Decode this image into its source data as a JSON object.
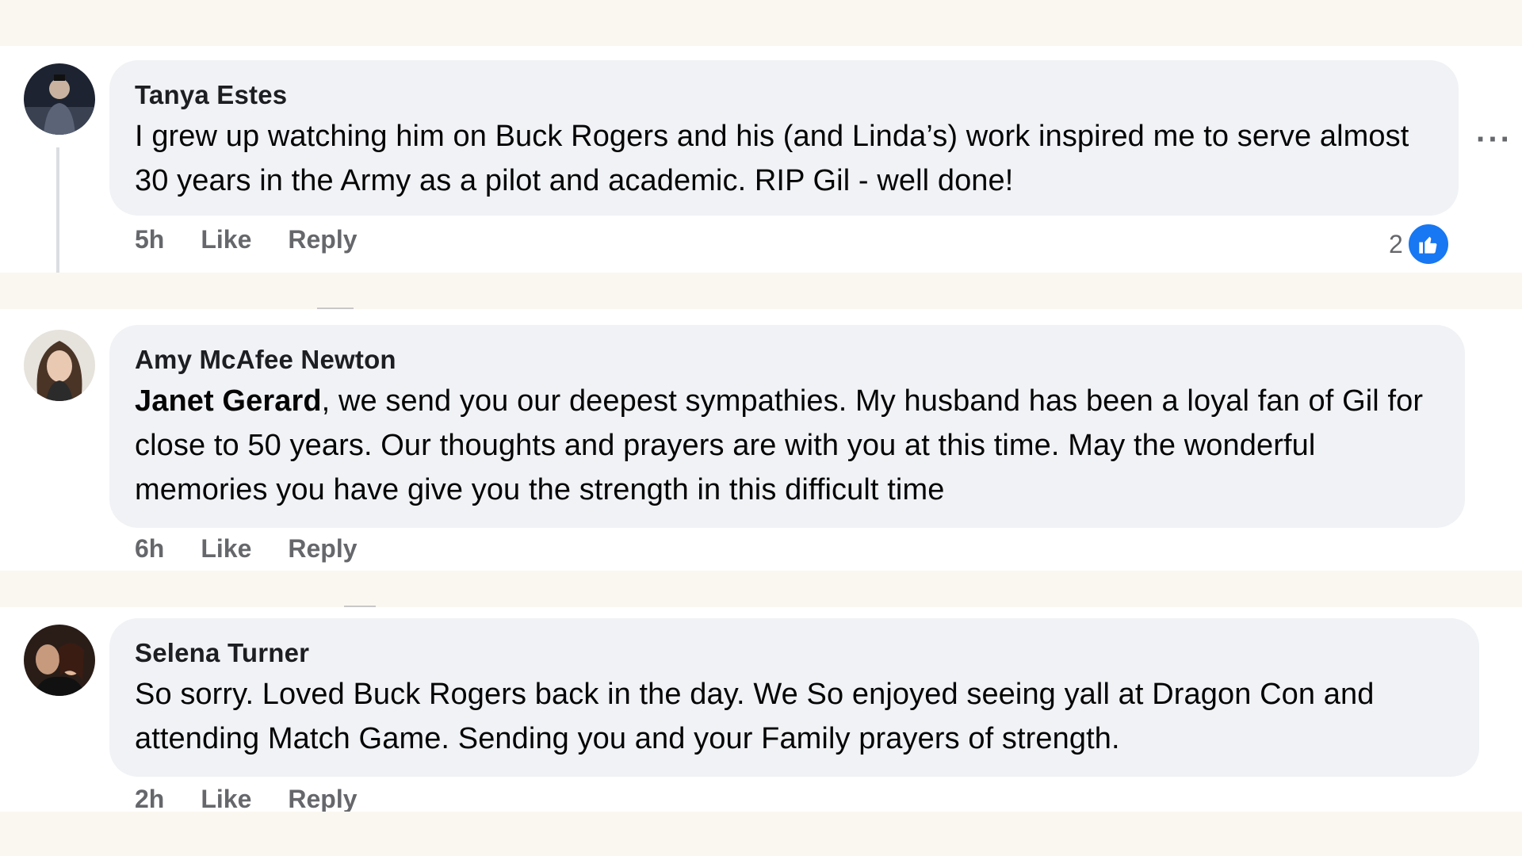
{
  "comments": [
    {
      "author": "Tanya Estes",
      "text": "I grew up watching him on Buck Rogers and his (and Linda’s) work inspired me to serve almost 30 years in the Army as a pilot and academic. RIP Gil - well done!",
      "time": "5h",
      "like_label": "Like",
      "reply_label": "Reply",
      "reaction_count": "2",
      "reaction_icon": "thumbs-up-icon",
      "more_label": "···"
    },
    {
      "author": "Amy McAfee Newton",
      "mention": "Janet Gerard",
      "text": ", we send you our deepest sympathies. My husband has been a loyal fan of Gil for close to 50 years. Our thoughts and prayers are with you at this time. May the wonderful memories you have give you the strength in this difficult time",
      "time": "6h",
      "like_label": "Like",
      "reply_label": "Reply"
    },
    {
      "author": "Selena Turner",
      "text": "So sorry. Loved Buck Rogers back in the day. We So enjoyed seeing yall at Dragon Con and attending Match Game. Sending you and your Family prayers of strength.",
      "time": "2h",
      "like_label": "Like",
      "reply_label": "Reply"
    }
  ],
  "colors": {
    "accent": "#1877f2",
    "bubble": "#f0f2f5",
    "secondary_text": "#65676b",
    "page_background": "#faf7f1"
  }
}
